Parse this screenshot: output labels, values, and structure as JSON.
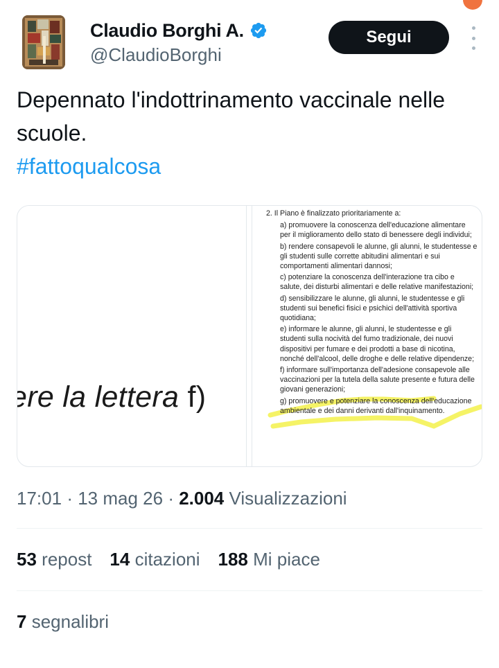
{
  "author": {
    "display_name": "Claudio Borghi A.",
    "handle": "@ClaudioBorghi",
    "verified": true,
    "verified_color": "#1d9bf0"
  },
  "actions": {
    "follow_label": "Segui",
    "more_icon": "more-vertical-icon"
  },
  "tweet": {
    "text": "Depennato l'indottrinamento vaccinale nelle scuole.",
    "hashtag": "#fattoqualcosa"
  },
  "media": {
    "left_snippet_main": "ere la lettera ",
    "left_snippet_paren": "f)",
    "document": {
      "lead": "2. Il Piano è finalizzato prioritariamente a:",
      "items": [
        "a) promuovere la conoscenza dell'educazione alimentare per il miglioramento dello stato di benessere degli individui;",
        "b) rendere consapevoli le alunne, gli alunni, le studentesse e gli studenti sulle corrette abitudini alimentari e sui comportamenti alimentari dannosi;",
        "c) potenziare la conoscenza dell'interazione tra cibo e salute, dei disturbi alimentari e delle relative manifestazioni;",
        "d) sensibilizzare le alunne, gli alunni, le studentesse e gli studenti sui benefici fisici e psichici dell'attività sportiva quotidiana;",
        "e) informare le alunne, gli alunni, le studentesse e gli studenti sulla nocività del fumo tradizionale, dei nuovi dispositivi per fumare e dei prodotti a base di nicotina, nonché dell'alcool, delle droghe e delle relative dipendenze;",
        "f) informare sull'importanza dell'adesione consapevole alle vaccinazioni per la tutela della salute presente e futura delle giovani generazioni;",
        "g) promuovere e potenziare la conoscenza dell'educazione ambientale e dei danni derivanti dall'inquinamento."
      ]
    },
    "highlight_color": "#f2f040"
  },
  "meta": {
    "time": "17:01",
    "date": "13 mag 26",
    "views_count": "2.004",
    "views_label": "Visualizzazioni"
  },
  "stats": {
    "reposts_count": "53",
    "reposts_label": "repost",
    "quotes_count": "14",
    "quotes_label": "citazioni",
    "likes_count": "188",
    "likes_label": "Mi piace",
    "bookmarks_count": "7",
    "bookmarks_label": "segnalibri"
  }
}
